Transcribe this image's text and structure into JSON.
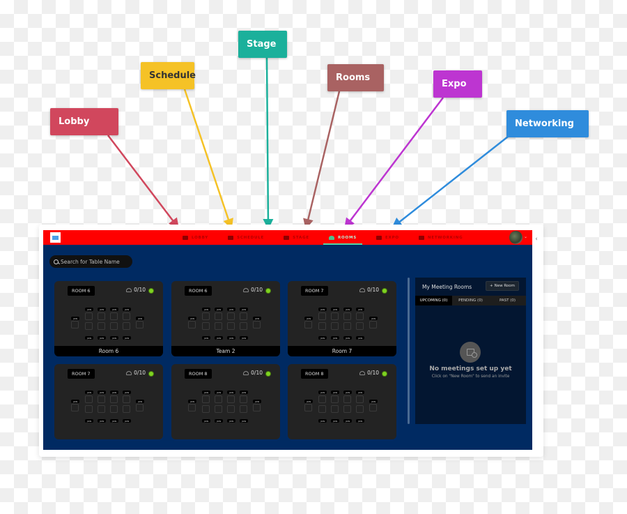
{
  "callouts": [
    {
      "id": "lobby",
      "label": "Lobby",
      "color": "#d1475d"
    },
    {
      "id": "schedule",
      "label": "Schedule",
      "color": "#f5c226"
    },
    {
      "id": "stage",
      "label": "Stage",
      "color": "#1bb09b"
    },
    {
      "id": "rooms",
      "label": "Rooms",
      "color": "#a96262"
    },
    {
      "id": "expo",
      "label": "Expo",
      "color": "#bd35d1"
    },
    {
      "id": "networking",
      "label": "Networking",
      "color": "#2f8cdc"
    }
  ],
  "app": {
    "topbar_color": "#ff0000",
    "background_color": "#002a62",
    "logo_icon": "logo-icon",
    "nav": [
      {
        "label": "LOBBY",
        "icon": "couch-icon",
        "active": false
      },
      {
        "label": "SCHEDULE",
        "icon": "calendar-icon",
        "active": false
      },
      {
        "label": "STAGE",
        "icon": "stage-icon",
        "active": false
      },
      {
        "label": "ROOMS",
        "icon": "tree-icon",
        "active": true
      },
      {
        "label": "EXPO",
        "icon": "booth-icon",
        "active": false
      },
      {
        "label": "NETWORKING",
        "icon": "people-icon",
        "active": false
      }
    ],
    "avatar_caret": "⌄",
    "collapse_glyph": "‹",
    "search": {
      "placeholder": "Search for Table Name",
      "value": ""
    },
    "join_label": "JOIN",
    "rooms": [
      {
        "badge": "ROOM 6",
        "count": "0/10",
        "name": "Room 6"
      },
      {
        "badge": "ROOM 6",
        "count": "0/10",
        "name": "Team 2"
      },
      {
        "badge": "ROOM 7",
        "count": "0/10",
        "name": "Room 7"
      },
      {
        "badge": "ROOM 7",
        "count": "0/10",
        "name": ""
      },
      {
        "badge": "ROOM 8",
        "count": "0/10",
        "name": ""
      },
      {
        "badge": "ROOM 8",
        "count": "0/10",
        "name": ""
      }
    ],
    "meetings": {
      "title": "My Meeting Rooms",
      "new_room_label": "New Room",
      "tabs": [
        {
          "label": "UPCOMING (0)",
          "active": true
        },
        {
          "label": "PENDING (0)",
          "active": false
        },
        {
          "label": "PAST (0)",
          "active": false
        }
      ],
      "empty_title": "No meetings set up yet",
      "empty_subtitle": "Click on \"New Room\" to send an invite"
    }
  }
}
